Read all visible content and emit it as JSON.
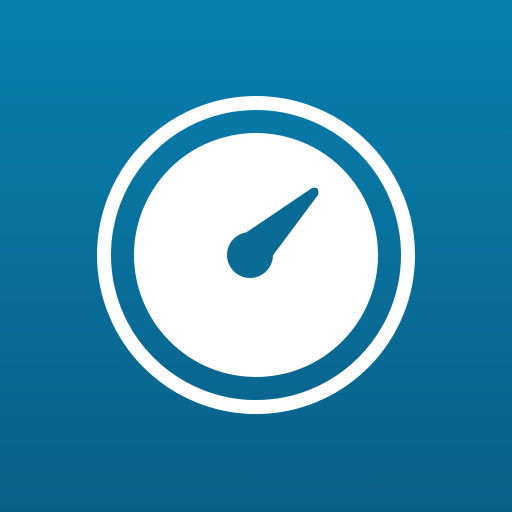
{
  "icon": {
    "name": "gauge-icon",
    "background_top": "#0780b0",
    "background_bottom": "#0a5f86",
    "foreground": "#ffffff"
  }
}
